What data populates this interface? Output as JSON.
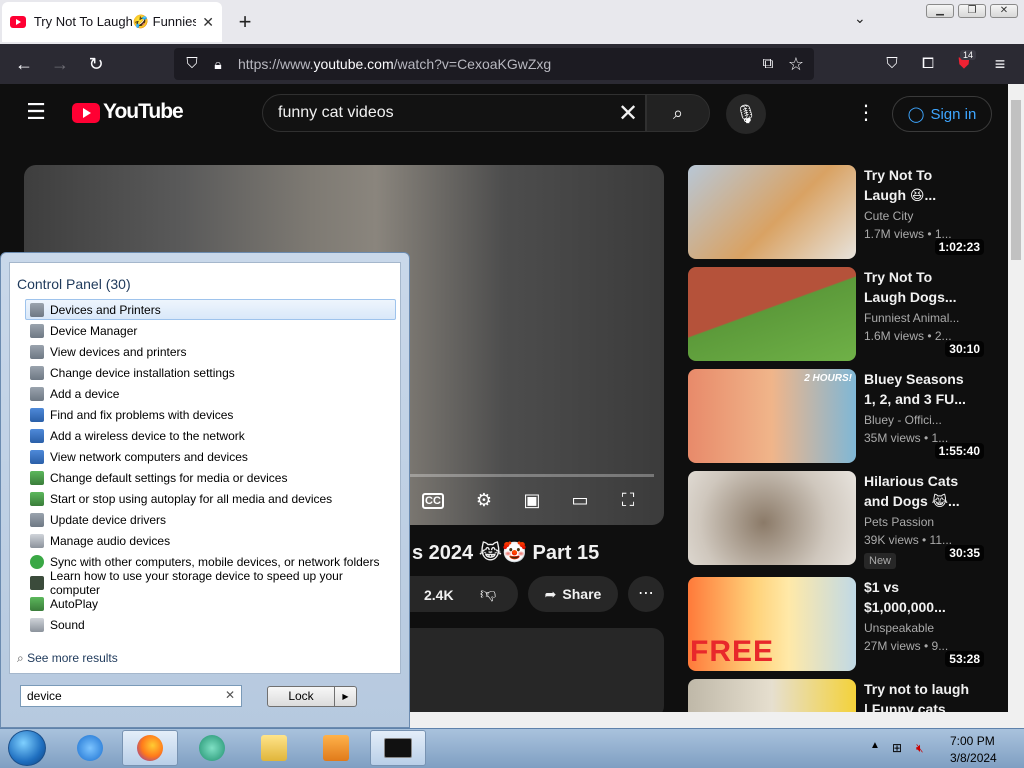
{
  "browser": {
    "tab_title": "Try Not To Laugh🤣 Funniest C",
    "tab_close": "✕",
    "new_tab": "+",
    "url_prefix": "https://www.",
    "url_host": "youtube.com",
    "url_path": "/watch?v=CexoaKGwZxg",
    "extension_badge": "14"
  },
  "youtube": {
    "logo_text": "YouTube",
    "search_query": "funny cat videos",
    "sign_in_label": "Sign in",
    "video_title_fragment": "s 2024 😹🤡 Part 15",
    "like_count": "2.4K",
    "share_label": "Share",
    "cc_label": "CC",
    "recommendations": [
      {
        "title": "Try Not To Laugh 😆...",
        "channel": "Cute City",
        "meta": "1.7M views  • 1...",
        "duration": "1:02:23"
      },
      {
        "title": "Try Not To Laugh Dogs...",
        "channel": "Funniest Animal...",
        "meta": "1.6M views  • 2...",
        "duration": "30:10"
      },
      {
        "title": "Bluey Seasons 1, 2, and 3 FU...",
        "channel": "Bluey - Offici...",
        "meta": "35M views  • 1...",
        "duration": "1:55:40"
      },
      {
        "title": "Hilarious Cats and Dogs 😹...",
        "channel": "Pets Passion",
        "meta": "39K views  • 11...",
        "duration": "30:35",
        "badge": "New"
      },
      {
        "title": "$1 vs $1,000,000...",
        "channel": "Unspeakable",
        "meta": "27M views  • 9...",
        "duration": "53:28"
      },
      {
        "title": "Try not to laugh | Funny cats",
        "channel": "",
        "meta": "",
        "duration": ""
      }
    ],
    "thumb_text": {
      "two_hours": "2 HOURS!",
      "free": "FREE"
    }
  },
  "start_menu": {
    "heading": "Control Panel (30)",
    "items": [
      {
        "label": "Devices and Printers",
        "icon": "printer-icon"
      },
      {
        "label": "Device Manager",
        "icon": "printer-icon"
      },
      {
        "label": "View devices and printers",
        "icon": "printer-icon"
      },
      {
        "label": "Change device installation settings",
        "icon": "printer-icon"
      },
      {
        "label": "Add a device",
        "icon": "printer-icon"
      },
      {
        "label": "Find and fix problems with devices",
        "icon": "network-icon"
      },
      {
        "label": "Add a wireless device to the network",
        "icon": "network-icon"
      },
      {
        "label": "View network computers and devices",
        "icon": "network-icon"
      },
      {
        "label": "Change default settings for media or devices",
        "icon": "autoplay-icon"
      },
      {
        "label": "Start or stop using autoplay for all media and devices",
        "icon": "autoplay-icon"
      },
      {
        "label": "Update device drivers",
        "icon": "printer-icon"
      },
      {
        "label": "Manage audio devices",
        "icon": "sound-icon"
      },
      {
        "label": "Sync with other computers, mobile devices, or network folders",
        "icon": "sync-icon"
      },
      {
        "label": "Learn how to use your storage device to speed up your computer",
        "icon": "storage-icon"
      },
      {
        "label": "AutoPlay",
        "icon": "autoplay-icon"
      },
      {
        "label": "Sound",
        "icon": "sound-icon"
      }
    ],
    "see_more": "See more results",
    "search_value": "device",
    "lock_label": "Lock"
  },
  "taskbar": {
    "time": "7:00 PM",
    "date": "3/8/2024"
  }
}
